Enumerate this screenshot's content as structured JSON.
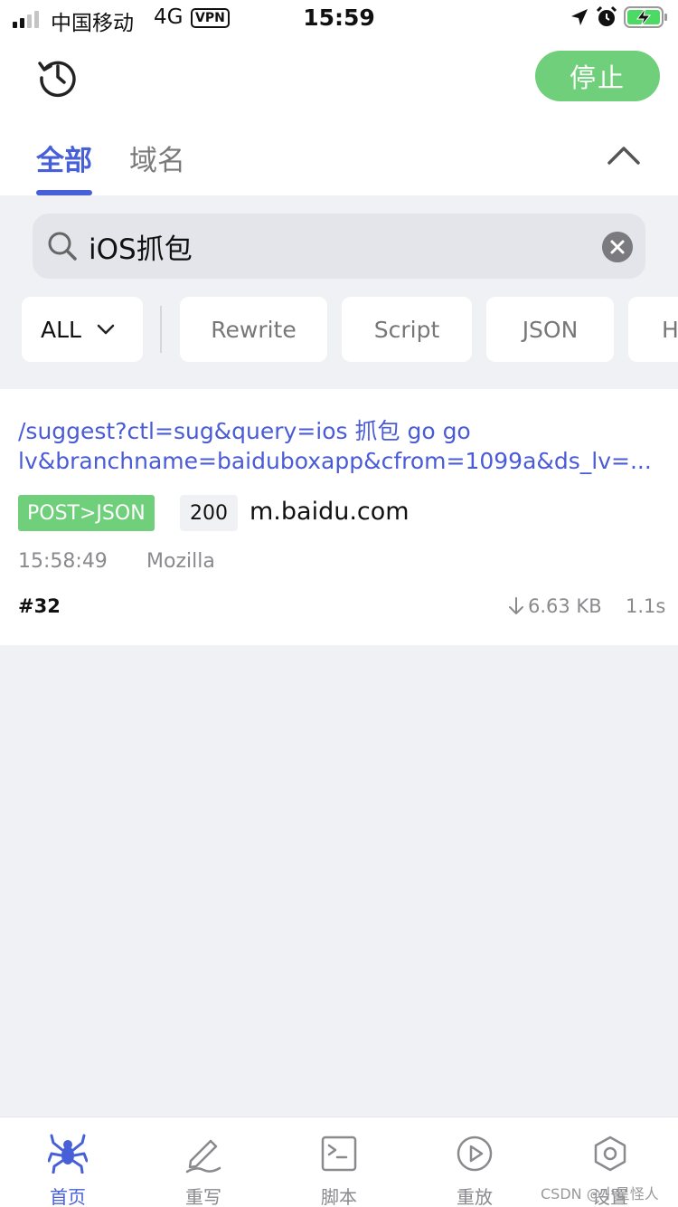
{
  "status_bar": {
    "carrier": "中国移动",
    "network": "4G",
    "vpn": "VPN",
    "time": "15:59"
  },
  "header": {
    "stop_label": "停止",
    "tabs": [
      {
        "label": "全部",
        "active": true
      },
      {
        "label": "域名",
        "active": false
      }
    ]
  },
  "search": {
    "value": "iOS抓包"
  },
  "filters": {
    "selected": "ALL",
    "chips": [
      "Rewrite",
      "Script",
      "JSON",
      "H"
    ]
  },
  "request": {
    "url_line1": "/suggest?ctl=sug&query=ios 抓包 go go",
    "url_line2": "lv&branchname=baiduboxapp&cfrom=1099a&ds_lv=...",
    "method": "POST>JSON",
    "status": "200",
    "host": "m.baidu.com",
    "time": "15:58:49",
    "user_agent": "Mozilla",
    "id": "#32",
    "size": "6.63 KB",
    "duration": "1.1s"
  },
  "tabbar": {
    "items": [
      {
        "label": "首页",
        "icon": "spider-icon",
        "active": true
      },
      {
        "label": "重写",
        "icon": "pen-icon",
        "active": false
      },
      {
        "label": "脚本",
        "icon": "terminal-icon",
        "active": false
      },
      {
        "label": "重放",
        "icon": "play-icon",
        "active": false
      },
      {
        "label": "设置",
        "icon": "settings-icon",
        "active": false
      }
    ]
  },
  "watermark": "CSDN @小星怪人",
  "colors": {
    "accent": "#4760d8",
    "green": "#6fcf7a",
    "background": "#f0f1f5"
  }
}
